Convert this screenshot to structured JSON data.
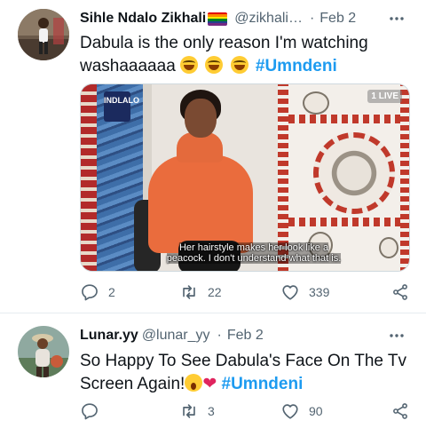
{
  "tweets": [
    {
      "author_name": "Sihle Ndalo Zikhali",
      "handle": "@zikhali…",
      "date": "Feb 2",
      "text_line1": "Dabula is the only reason I'm watching",
      "text_line2": "washaaaaaa",
      "hashtag": "#Umndeni",
      "media": {
        "show_logo": "INDLALO",
        "channel_logo": "1 LIVE",
        "caption_line1": "Her hairstyle makes her look like a",
        "caption_line2": "peacock. I don't understand what that is."
      },
      "replies": "2",
      "retweets": "22",
      "likes": "339"
    },
    {
      "author_name": "Lunar.yy",
      "handle": "@lunar_yy",
      "date": "Feb 2",
      "text_line1": "So Happy To See Dabula's Face On The Tv",
      "text_line2": "Screen Again!",
      "hashtag": "#Umndeni",
      "replies": "",
      "retweets": "3",
      "likes": "90"
    }
  ],
  "colors": {
    "hashtag": "#1d9bf0",
    "muted": "#536471",
    "text": "#0f1419",
    "divider": "#e6ecf0"
  },
  "icons": [
    "more-icon",
    "reply-icon",
    "retweet-icon",
    "like-icon",
    "share-icon",
    "rainbow-flag-icon",
    "grinning-sweat-emoji-icon",
    "crying-emoji-icon",
    "red-heart-emoji-icon"
  ]
}
